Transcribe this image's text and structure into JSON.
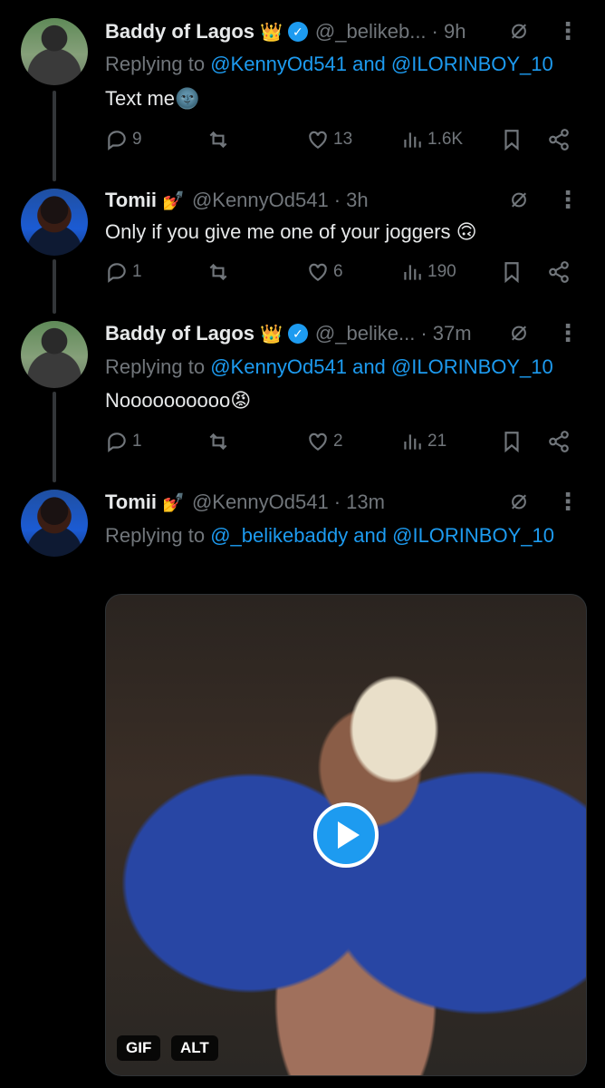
{
  "tweets": [
    {
      "name": "Baddy of Lagos",
      "emoji": "👑",
      "verified": true,
      "handle": "@_belikeb...",
      "time": "· 9h",
      "replying_prefix": "Replying to",
      "replying_users": "@KennyOd541 and @ILORINBOY_10",
      "text": "Text me🌚",
      "stats": {
        "replies": "9",
        "reposts": "",
        "likes": "13",
        "views": "1.6K"
      }
    },
    {
      "name": "Tomii",
      "emoji": "💅",
      "verified": false,
      "handle": "@KennyOd541",
      "time": "· 3h",
      "text": "Only if you give me one of your joggers 🙃",
      "stats": {
        "replies": "1",
        "reposts": "",
        "likes": "6",
        "views": "190"
      }
    },
    {
      "name": "Baddy of Lagos",
      "emoji": "👑",
      "verified": true,
      "handle": "@_belike...",
      "time": "· 37m",
      "replying_prefix": "Replying to",
      "replying_users": "@KennyOd541 and @ILORINBOY_10",
      "text": "Noooooooooo😡",
      "stats": {
        "replies": "1",
        "reposts": "",
        "likes": "2",
        "views": "21"
      }
    },
    {
      "name": "Tomii",
      "emoji": "💅",
      "verified": false,
      "handle": "@KennyOd541",
      "time": "· 13m",
      "replying_prefix": "Replying to",
      "replying_users": "@_belikebaddy and @ILORINBOY_10",
      "media": {
        "badge_gif": "GIF",
        "badge_alt": "ALT"
      }
    }
  ],
  "icons": {
    "grok": "grok-icon",
    "more": "more-icon",
    "reply": "reply-icon",
    "repost": "repost-icon",
    "like": "heart-icon",
    "views": "views-icon",
    "bookmark": "bookmark-icon",
    "share": "share-icon",
    "play": "play-icon"
  },
  "colors": {
    "accent": "#1d9bf0",
    "muted": "#71767b",
    "text": "#e7e9ea",
    "background": "#000000"
  }
}
